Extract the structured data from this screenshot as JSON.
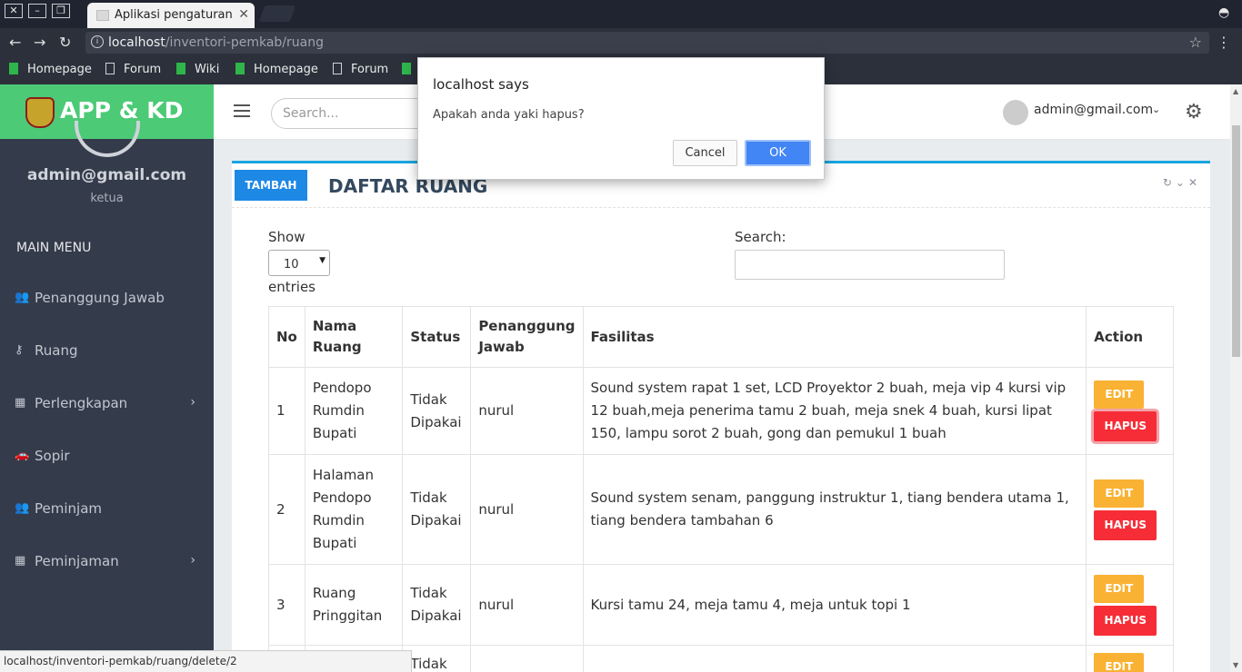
{
  "browser": {
    "tab_title": "Aplikasi pengaturan r",
    "url_host": "localhost",
    "url_path": "/inventori-pemkab/ruang",
    "bookmarks": [
      {
        "label": "Homepage",
        "icon": "green-bookmark-icon"
      },
      {
        "label": "Forum",
        "icon": "page-icon"
      },
      {
        "label": "Wiki",
        "icon": "green-bookmark-icon"
      },
      {
        "label": "Homepage",
        "icon": "green-bookmark-icon"
      },
      {
        "label": "Forum",
        "icon": "page-icon"
      }
    ],
    "status_url": "localhost/inventori-pemkab/ruang/delete/2"
  },
  "app": {
    "brand": "APP & KD",
    "user_email": "admin@gmail.com",
    "user_role": "ketua",
    "menu_header": "MAIN MENU",
    "menu": [
      {
        "label": "Penanggung Jawab",
        "icon": "users-icon",
        "has_sub": false
      },
      {
        "label": "Ruang",
        "icon": "key-icon",
        "has_sub": false
      },
      {
        "label": "Perlengkapan",
        "icon": "grid-icon",
        "has_sub": true
      },
      {
        "label": "Sopir",
        "icon": "car-icon",
        "has_sub": false
      },
      {
        "label": "Peminjam",
        "icon": "users-icon",
        "has_sub": false
      },
      {
        "label": "Peminjaman",
        "icon": "grid-icon",
        "has_sub": true
      }
    ],
    "topnav": {
      "search_placeholder": "Search...",
      "account_email": "admin@gmail.com"
    }
  },
  "panel": {
    "add_button": "TAMBAH",
    "title": "DAFTAR RUANG",
    "show_label": "Show",
    "show_value": "10",
    "entries_label": "entries",
    "search_label": "Search:",
    "columns": [
      "No",
      "Nama Ruang",
      "Status",
      "Penanggung Jawab",
      "Fasilitas",
      "Action"
    ],
    "rows": [
      {
        "no": "1",
        "nama": "Pendopo Rumdin Bupati",
        "status": "Tidak Dipakai",
        "pj": "nurul",
        "fasilitas": "Sound system rapat 1 set, LCD Proyektor 2 buah, meja vip 4 kursi vip 12 buah,meja penerima tamu 2 buah, meja snek 4 buah, kursi lipat 150, lampu sorot 2 buah, gong dan pemukul 1 buah"
      },
      {
        "no": "2",
        "nama": "Halaman Pendopo Rumdin Bupati",
        "status": "Tidak Dipakai",
        "pj": "nurul",
        "fasilitas": "Sound system senam, panggung instruktur 1, tiang bendera utama 1, tiang bendera tambahan 6"
      },
      {
        "no": "3",
        "nama": "Ruang Pringgitan",
        "status": "Tidak Dipakai",
        "pj": "nurul",
        "fasilitas": "Kursi tamu 24, meja tamu 4, meja untuk topi 1"
      },
      {
        "no": "",
        "nama": "",
        "status": "Tidak",
        "pj": "",
        "fasilitas": ""
      }
    ],
    "edit_label": "EDIT",
    "delete_label": "HAPUS"
  },
  "dialog": {
    "title": "localhost says",
    "message": "Apakah anda yaki hapus?",
    "cancel": "Cancel",
    "ok": "OK"
  }
}
